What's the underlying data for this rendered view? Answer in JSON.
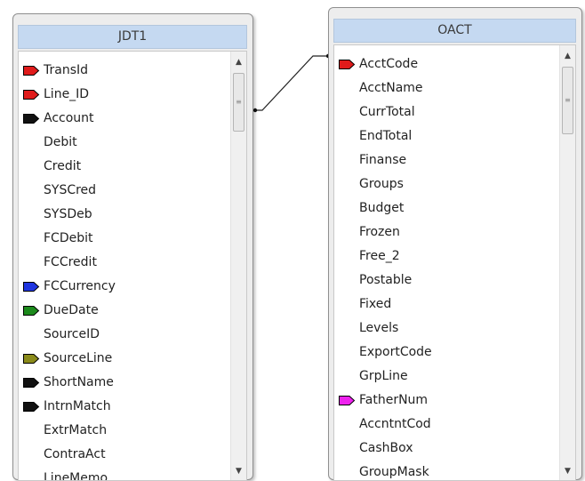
{
  "tables": [
    {
      "name": "JDT1",
      "fields": [
        {
          "label": "TransId",
          "marker": "red"
        },
        {
          "label": "Line_ID",
          "marker": "red"
        },
        {
          "label": "Account",
          "marker": "black"
        },
        {
          "label": "Debit",
          "marker": ""
        },
        {
          "label": "Credit",
          "marker": ""
        },
        {
          "label": "SYSCred",
          "marker": ""
        },
        {
          "label": "SYSDeb",
          "marker": ""
        },
        {
          "label": "FCDebit",
          "marker": ""
        },
        {
          "label": "FCCredit",
          "marker": ""
        },
        {
          "label": "FCCurrency",
          "marker": "blue"
        },
        {
          "label": "DueDate",
          "marker": "green"
        },
        {
          "label": "SourceID",
          "marker": ""
        },
        {
          "label": "SourceLine",
          "marker": "olive"
        },
        {
          "label": "ShortName",
          "marker": "black"
        },
        {
          "label": "IntrnMatch",
          "marker": "black"
        },
        {
          "label": "ExtrMatch",
          "marker": ""
        },
        {
          "label": "ContraAct",
          "marker": ""
        },
        {
          "label": "LineMemo",
          "marker": ""
        }
      ]
    },
    {
      "name": "OACT",
      "fields": [
        {
          "label": "AcctCode",
          "marker": "red"
        },
        {
          "label": "AcctName",
          "marker": ""
        },
        {
          "label": "CurrTotal",
          "marker": ""
        },
        {
          "label": "EndTotal",
          "marker": ""
        },
        {
          "label": "Finanse",
          "marker": ""
        },
        {
          "label": "Groups",
          "marker": ""
        },
        {
          "label": "Budget",
          "marker": ""
        },
        {
          "label": "Frozen",
          "marker": ""
        },
        {
          "label": "Free_2",
          "marker": ""
        },
        {
          "label": "Postable",
          "marker": ""
        },
        {
          "label": "Fixed",
          "marker": ""
        },
        {
          "label": "Levels",
          "marker": ""
        },
        {
          "label": "ExportCode",
          "marker": ""
        },
        {
          "label": "GrpLine",
          "marker": ""
        },
        {
          "label": "FatherNum",
          "marker": "magenta"
        },
        {
          "label": "AccntntCod",
          "marker": ""
        },
        {
          "label": "CashBox",
          "marker": ""
        },
        {
          "label": "GroupMask",
          "marker": ""
        }
      ]
    }
  ],
  "relationship": {
    "from_table": "JDT1",
    "from_field": "Account",
    "to_table": "OACT",
    "to_field": "AcctCode"
  },
  "marker_colors": {
    "red": "#e01b1b",
    "black": "#111111",
    "blue": "#1f35e0",
    "green": "#1c8a1c",
    "olive": "#8a8a1a",
    "magenta": "#ee22ee"
  },
  "icons": {
    "scroll_up": "scroll-up-arrow-icon",
    "scroll_down": "scroll-down-arrow-icon"
  }
}
